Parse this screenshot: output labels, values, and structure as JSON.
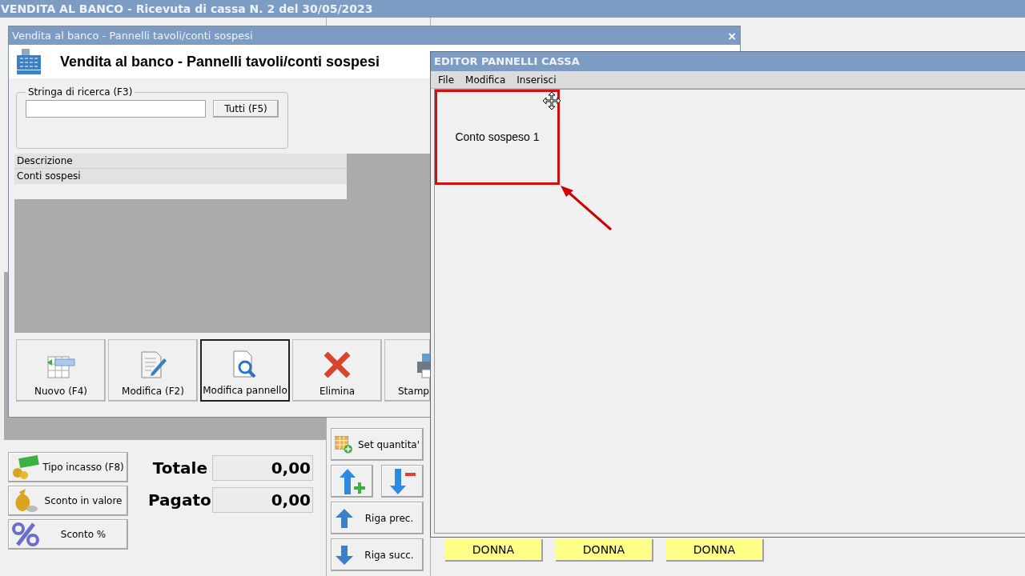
{
  "main_window": {
    "title": "VENDITA AL BANCO - Ricevuta di cassa N. 2 del 30/05/2023",
    "payment_buttons": [
      "Tipo incasso (F8)",
      "Sconto in valore",
      "Sconto %"
    ],
    "totals": [
      {
        "label": "Totale",
        "value": "0,00"
      },
      {
        "label": "Pagato",
        "value": "0,00"
      }
    ],
    "side_buttons": [
      "Set quantita'",
      "Riga prec.",
      "Riga succ."
    ],
    "panel_buttons": [
      "DONNA",
      "DONNA",
      "DONNA"
    ]
  },
  "dialog": {
    "title": "Vendita al banco - Pannelli tavoli/conti sospesi",
    "close": "×",
    "heading": "Vendita al banco - Pannelli tavoli/conti sospesi",
    "search": {
      "legend": "Stringa di ricerca (F3)",
      "button": "Tutti (F5)"
    },
    "table": {
      "columns": [
        "Descrizione"
      ],
      "rows": [
        [
          "Conti sospesi"
        ]
      ]
    },
    "buttons": [
      {
        "label": "Nuovo (F4)",
        "focused": false
      },
      {
        "label": "Modifica (F2)",
        "focused": false
      },
      {
        "label": "Modifica pannello",
        "focused": true
      },
      {
        "label": "Elimina",
        "focused": false
      },
      {
        "label": "Stamp",
        "focused": false
      }
    ]
  },
  "editor": {
    "title": "EDITOR PANNELLI CASSA",
    "menu": [
      "File",
      "Modifica",
      "Inserisci"
    ],
    "panel_items": [
      {
        "label": "Conto sospeso 1",
        "highlighted": true
      }
    ]
  }
}
